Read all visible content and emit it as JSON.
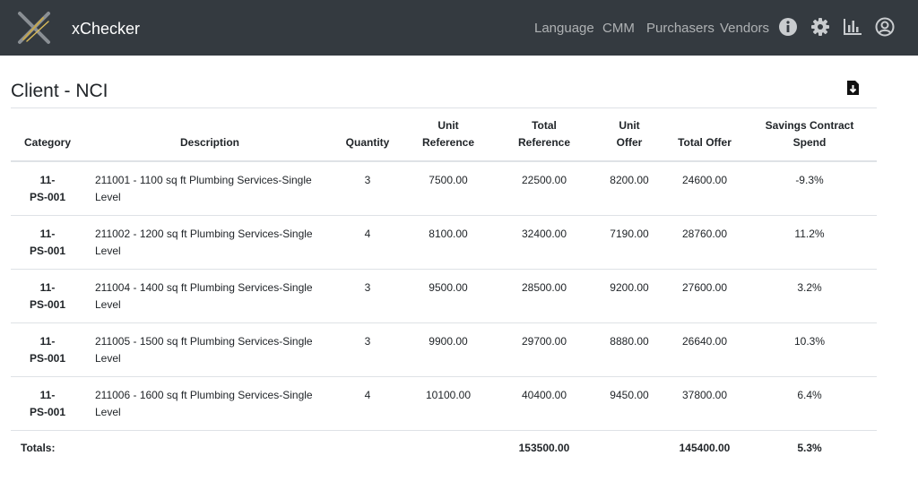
{
  "navbar": {
    "brand": "xChecker",
    "links": [
      "Language",
      "CMM",
      "Purchasers",
      "Vendors"
    ],
    "icons": [
      "info-icon",
      "settings-gear-icon",
      "bar-chart-icon",
      "user-account-icon"
    ]
  },
  "page": {
    "title": "Client - NCI",
    "export_icon": "file-download-icon"
  },
  "table": {
    "headers": {
      "category": "Category",
      "description": "Description",
      "quantity": "Quantity",
      "unit_ref_1": "Unit",
      "unit_ref_2": "Reference",
      "total_ref_1": "Total",
      "total_ref_2": "Reference",
      "unit_offer_1": "Unit",
      "unit_offer_2": "Offer",
      "total_offer": "Total Offer",
      "savings_1": "Savings Contract",
      "savings_2": "Spend"
    },
    "rows": [
      {
        "cat1": "11-",
        "cat2": "PS-001",
        "desc1": "211001 - 1100 sq ft Plumbing Services-Single",
        "desc2": "Level",
        "qty": "3",
        "unit_ref": "7500.00",
        "total_ref": "22500.00",
        "unit_offer": "8200.00",
        "total_offer": "24600.00",
        "savings": "-9.3%"
      },
      {
        "cat1": "11-",
        "cat2": "PS-001",
        "desc1": "211002 - 1200 sq ft Plumbing Services-Single",
        "desc2": "Level",
        "qty": "4",
        "unit_ref": "8100.00",
        "total_ref": "32400.00",
        "unit_offer": "7190.00",
        "total_offer": "28760.00",
        "savings": "11.2%"
      },
      {
        "cat1": "11-",
        "cat2": "PS-001",
        "desc1": "211004 - 1400 sq ft Plumbing Services-Single",
        "desc2": "Level",
        "qty": "3",
        "unit_ref": "9500.00",
        "total_ref": "28500.00",
        "unit_offer": "9200.00",
        "total_offer": "27600.00",
        "savings": "3.2%"
      },
      {
        "cat1": "11-",
        "cat2": "PS-001",
        "desc1": "211005 - 1500 sq ft Plumbing Services-Single",
        "desc2": "Level",
        "qty": "3",
        "unit_ref": "9900.00",
        "total_ref": "29700.00",
        "unit_offer": "8880.00",
        "total_offer": "26640.00",
        "savings": "10.3%"
      },
      {
        "cat1": "11-",
        "cat2": "PS-001",
        "desc1": "211006 - 1600 sq ft Plumbing Services-Single",
        "desc2": "Level",
        "qty": "4",
        "unit_ref": "10100.00",
        "total_ref": "40400.00",
        "unit_offer": "9450.00",
        "total_offer": "37800.00",
        "savings": "6.4%"
      }
    ],
    "totals": {
      "label": "Totals:",
      "total_ref": "153500.00",
      "total_offer": "145400.00",
      "savings": "5.3%"
    }
  }
}
